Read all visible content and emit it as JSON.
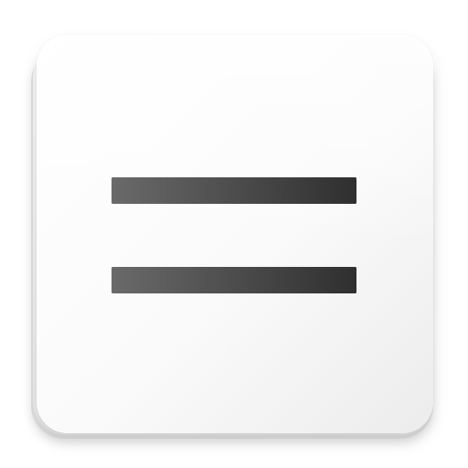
{
  "icon": {
    "name": "equals-icon",
    "colors": {
      "tile_top": "#ffffff",
      "tile_bottom": "#ececec",
      "bar_left": "#6a6a6a",
      "bar_right": "#2f2f2f"
    }
  }
}
